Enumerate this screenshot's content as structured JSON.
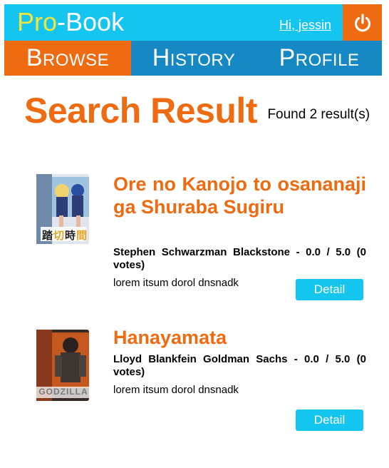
{
  "header": {
    "logo_part1": "Pro",
    "logo_part2": "-Book",
    "greeting": "Hi, jessin",
    "logout_icon": "power-icon",
    "colors": {
      "bar": "#14c5f0",
      "accent": "#ee6b12",
      "logo_pro": "#f2e53c"
    }
  },
  "nav": {
    "tabs": [
      {
        "label": "Browse",
        "active": true
      },
      {
        "label": "History",
        "active": false
      },
      {
        "label": "Profile",
        "active": false
      }
    ],
    "color": "#1688c4"
  },
  "main": {
    "title": "Search Result",
    "result_count": "Found 2 result(s)"
  },
  "results": [
    {
      "title": "Ore no Kanojo to osananaji ga Shuraba Sugiru",
      "author_rating": "Stephen Schwarzman Blackstone - 0.0 / 5.0 (0 votes)",
      "description": "lorem itsum dorol dnsnadk",
      "button": "Detail",
      "cover_icon": "anime-folder-icon",
      "cover_caption": "踏切時間"
    },
    {
      "title": "Hanayamata",
      "author_rating": "Lloyd Blankfein Goldman Sachs - 0.0 / 5.0 (0 votes)",
      "description": "lorem itsum dorol dnsnadk",
      "button": "Detail",
      "cover_icon": "godzilla-folder-icon",
      "cover_caption": "GODZILLA"
    }
  ]
}
